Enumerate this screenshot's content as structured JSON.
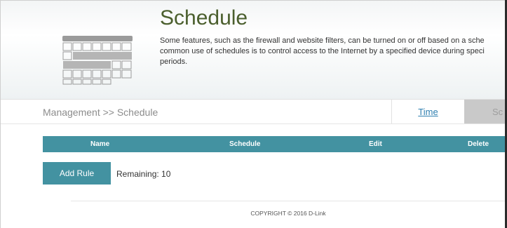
{
  "header": {
    "title": "Schedule",
    "description_lines": [
      "Some features, such as the firewall and website filters, can be turned on or off based on a sche",
      "common use of schedules is to control access to the Internet by a specified device during speci",
      "periods."
    ]
  },
  "nav": {
    "breadcrumb": "Management >> Schedule",
    "tab_time": "Time",
    "tab_schedule": "Sc"
  },
  "table": {
    "columns": [
      "Name",
      "Schedule",
      "Edit",
      "Delete"
    ]
  },
  "actions": {
    "add_rule": "Add Rule",
    "remaining": "Remaining: 10"
  },
  "footer": {
    "copyright": "COPYRIGHT © 2016 D-Link"
  },
  "colors": {
    "accent": "#4392a1",
    "title": "#4b5f2e",
    "link": "#2f7fb0"
  },
  "icons": {
    "header_icon": "calendar-icon"
  }
}
